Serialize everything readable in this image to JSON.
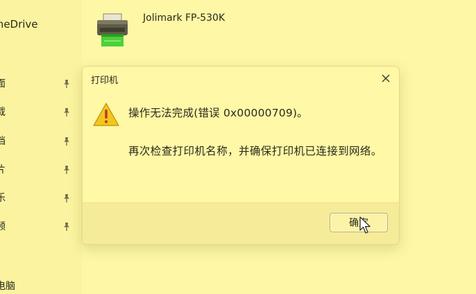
{
  "nav": {
    "top_label": "OneDrive",
    "items": [
      {
        "label": "面",
        "icon": "pin-icon"
      },
      {
        "label": "载",
        "icon": "pin-icon"
      },
      {
        "label": "档",
        "icon": "pin-icon"
      },
      {
        "label": "片",
        "icon": "pin-icon"
      },
      {
        "label": "乐",
        "icon": "pin-icon"
      },
      {
        "label": "频",
        "icon": "pin-icon"
      }
    ],
    "bottom_label": "电脑"
  },
  "printer": {
    "name": "Jolimark FP-530K",
    "icon": "printer-icon"
  },
  "dialog": {
    "title": "打印机",
    "close_icon": "close-icon",
    "warning_icon": "warning-icon",
    "message": "操作无法完成(错误 0x00000709)。",
    "detail": "再次检查打印机名称，并确保打印机已连接到网络。",
    "ok_label": "确定"
  },
  "colors": {
    "background": "#fdf7a6",
    "dialog_body": "#fff8a6",
    "dialog_footer": "#f6eb98",
    "warning_yellow": "#f3c61e",
    "warning_mark": "#c0392b",
    "printer_green": "#4cd137"
  }
}
